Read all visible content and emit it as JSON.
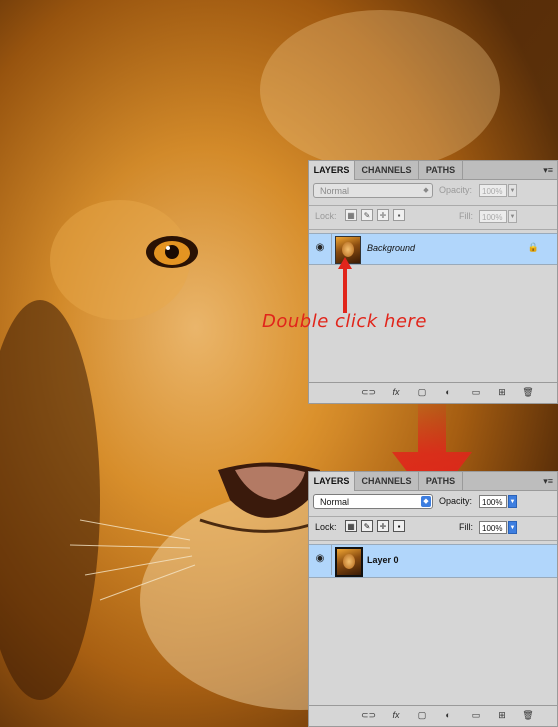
{
  "background": {
    "label": "lion-photo"
  },
  "colors": {
    "accent": "#3d7ee0",
    "selection": "#b1d6fb",
    "annotation": "#e1251b"
  },
  "panel_before": {
    "tabs": [
      "LAYERS",
      "CHANNELS",
      "PATHS"
    ],
    "menu_glyph": "▾≡",
    "blend_mode": "Normal",
    "opacity_label": "Opacity:",
    "opacity_value": "100%",
    "lock_label": "Lock:",
    "fill_label": "Fill:",
    "fill_value": "100%",
    "layer_name": "Background",
    "layer_locked": true
  },
  "annotation_text": "Double click here",
  "panel_after": {
    "tabs": [
      "LAYERS",
      "CHANNELS",
      "PATHS"
    ],
    "menu_glyph": "▾≡",
    "blend_mode": "Normal",
    "opacity_label": "Opacity:",
    "opacity_value": "100%",
    "lock_label": "Lock:",
    "fill_label": "Fill:",
    "fill_value": "100%",
    "layer_name": "Layer 0"
  },
  "footer_icons": [
    "link-icon",
    "fx-icon",
    "mask-icon",
    "adjustment-icon",
    "group-folder-icon",
    "new-layer-icon",
    "trash-icon"
  ],
  "footer_glyphs": [
    "⊂⊃",
    "fx",
    "▢",
    "◐",
    "▭",
    "⊞",
    "🗑"
  ]
}
